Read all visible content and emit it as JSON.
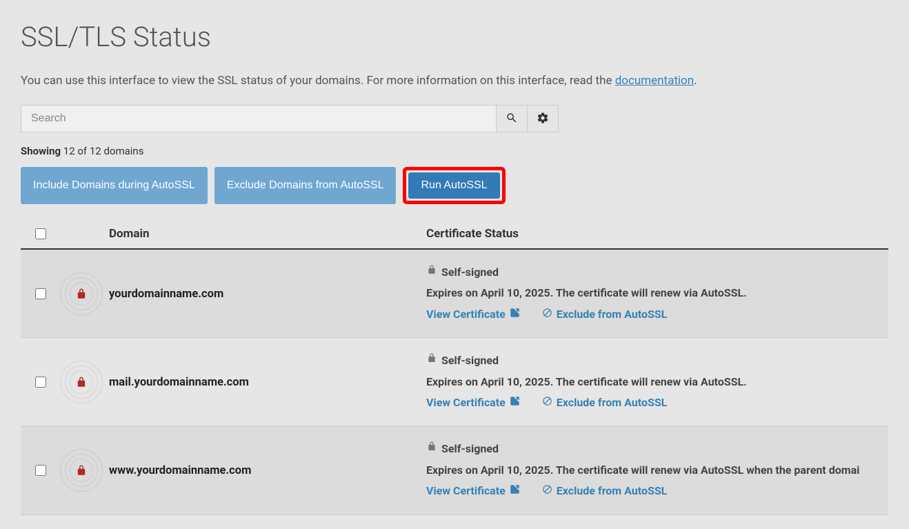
{
  "header": {
    "title": "SSL/TLS Status"
  },
  "description": {
    "prefix": "You can use this interface to view the SSL status of your domains. For more information on this interface, read the ",
    "link_text": "documentation",
    "suffix": "."
  },
  "search": {
    "placeholder": "Search"
  },
  "showing": {
    "label": "Showing",
    "text": " 12 of 12 domains"
  },
  "buttons": {
    "include": "Include Domains during AutoSSL",
    "exclude": "Exclude Domains from AutoSSL",
    "run": "Run AutoSSL"
  },
  "table": {
    "headers": {
      "domain": "Domain",
      "status": "Certificate Status"
    },
    "rows": [
      {
        "domain": "yourdomainname.com",
        "status_title": "Self-signed",
        "status_detail": "Expires on April 10, 2025. The certificate will renew via AutoSSL.",
        "view_link": "View Certificate",
        "exclude_link": "Exclude from AutoSSL",
        "shaded": true
      },
      {
        "domain": "mail.yourdomainname.com",
        "status_title": "Self-signed",
        "status_detail": "Expires on April 10, 2025. The certificate will renew via AutoSSL.",
        "view_link": "View Certificate",
        "exclude_link": "Exclude from AutoSSL",
        "shaded": false
      },
      {
        "domain": "www.yourdomainname.com",
        "status_title": "Self-signed",
        "status_detail": "Expires on April 10, 2025. The certificate will renew via AutoSSL when the parent domai",
        "view_link": "View Certificate",
        "exclude_link": "Exclude from AutoSSL",
        "shaded": true
      }
    ]
  }
}
